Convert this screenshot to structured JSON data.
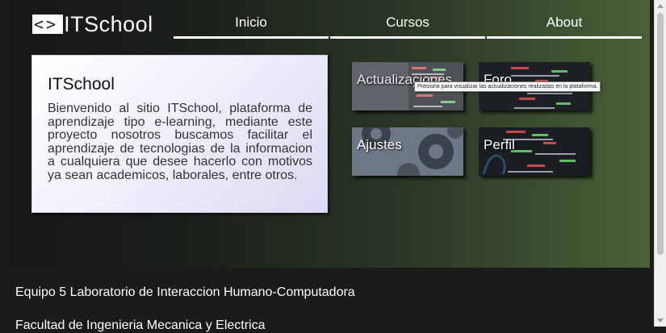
{
  "header": {
    "logo_brackets": "<>",
    "logo_text": "ITSchool"
  },
  "nav": {
    "items": [
      "Inicio",
      "Cursos",
      "About"
    ]
  },
  "intro_card": {
    "title": "ITSchool",
    "body": "Bienvenido al sitio ITSchool, plataforma de aprendizaje tipo e-learning, mediante este proyecto nosotros buscamos facilitar el aprendizaje de tecnologias de la informacion a cualquiera que desee hacerlo con motivos ya sean academicos, laborales, entre otros."
  },
  "tiles": [
    {
      "label": "Actualizaciones"
    },
    {
      "label": "Foro"
    },
    {
      "label": "Ajustes"
    },
    {
      "label": "Perfil"
    }
  ],
  "tooltip": "Presiona para visualizar las actualizaciones realizadas en la plataforma.",
  "footer": {
    "line1": "Equipo 5 Laboratorio de Interaccion Humano-Computadora",
    "line2": "Facultad de Ingenieria Mecanica y Electrica"
  },
  "colors": {
    "hero_dark": "#151815",
    "hero_green": "#4a6138",
    "page_bg": "#1b1b1b",
    "card_tint": "#dcd9f4"
  }
}
